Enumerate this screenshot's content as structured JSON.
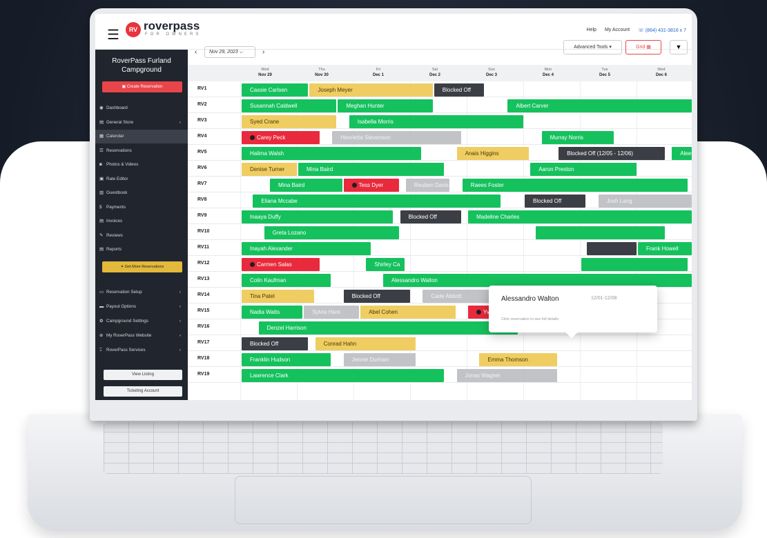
{
  "app": {
    "brand": "roverpass",
    "brand_sub": "FOR OWNERS",
    "menu_icon": "hamburger-icon",
    "logo_icon": "rv-logo-icon"
  },
  "topbar": {
    "help": "Help",
    "account": "My Account",
    "phone": "(864) 431-3816 x 7"
  },
  "sidebar": {
    "campground": "RoverPass Furland Campground",
    "create_button": "Create Reservation",
    "items": [
      {
        "label": "Dashboard",
        "icon": "dashboard-icon"
      },
      {
        "label": "General Store",
        "icon": "store-icon"
      },
      {
        "label": "Calendar",
        "icon": "calendar-icon"
      },
      {
        "label": "Reservations",
        "icon": "reservations-icon"
      },
      {
        "label": "Photos & Videos",
        "icon": "camera-icon"
      },
      {
        "label": "Rate Editor",
        "icon": "rate-icon"
      },
      {
        "label": "Guestbook",
        "icon": "book-icon"
      },
      {
        "label": "Payments",
        "icon": "dollar-icon"
      },
      {
        "label": "Invoices",
        "icon": "invoice-icon"
      },
      {
        "label": "Reviews",
        "icon": "reviews-icon"
      },
      {
        "label": "Reports",
        "icon": "reports-icon"
      }
    ],
    "get_more": "Get More Reservations",
    "settings": [
      {
        "label": "Reservation Setup",
        "icon": "setup-icon"
      },
      {
        "label": "Payout Options",
        "icon": "payout-icon"
      },
      {
        "label": "Campground Settings",
        "icon": "settings-icon"
      },
      {
        "label": "My RoverPass Website",
        "icon": "website-icon"
      },
      {
        "label": "RoverPass Services",
        "icon": "services-icon"
      }
    ],
    "view_listing": "View Listing",
    "ticketing": "Ticketing Account"
  },
  "toolbar": {
    "date": "Nov 29, 2023",
    "advanced_tools": "Advanced Tools",
    "grid": "Grid",
    "prev_arrow": "‹",
    "next_arrow": "›"
  },
  "calendar": {
    "days": [
      {
        "dow": "Wed",
        "date": "Nov 29"
      },
      {
        "dow": "Thu",
        "date": "Nov 30"
      },
      {
        "dow": "Fri",
        "date": "Dec 1"
      },
      {
        "dow": "Sat",
        "date": "Dec 2"
      },
      {
        "dow": "Sun",
        "date": "Dec 3"
      },
      {
        "dow": "Mon",
        "date": "Dec 4"
      },
      {
        "dow": "Tue",
        "date": "Dec 5"
      },
      {
        "dow": "Wed",
        "date": "Dec 6"
      },
      {
        "dow": "Thu",
        "date": "Dec"
      }
    ],
    "rows": [
      {
        "site": "RV1",
        "bars": [
          {
            "name": "Cassie Carlsen",
            "status": "checked-in",
            "start": 0,
            "len": 1.2
          },
          {
            "name": "Joseph Meyer",
            "status": "pending",
            "start": 1.2,
            "len": 2.2
          },
          {
            "name": "Blocked Off",
            "status": "blocked",
            "start": 3.4,
            "len": 0.9
          }
        ]
      },
      {
        "site": "RV2",
        "bars": [
          {
            "name": "Susannah Caldwell",
            "status": "checked-in",
            "start": 0,
            "len": 1.7
          },
          {
            "name": "Meghan Hunter",
            "status": "checked-in",
            "start": 1.7,
            "len": 1.7
          },
          {
            "name": "Albert Carver",
            "status": "checked-in",
            "start": 4.7,
            "len": 4.3
          }
        ]
      },
      {
        "site": "RV3",
        "bars": [
          {
            "name": "Syed Crane",
            "status": "pending",
            "start": 0,
            "len": 1.7
          },
          {
            "name": "Isabella Morris",
            "status": "checked-in",
            "start": 1.9,
            "len": 3.1
          }
        ]
      },
      {
        "site": "RV4",
        "bars": [
          {
            "name": "Carey Peck",
            "status": "cancelled",
            "start": 0,
            "len": 1.4
          },
          {
            "name": "Henrietta Stevenson",
            "status": "unconfirmed",
            "start": 1.6,
            "len": 2.3
          },
          {
            "name": "Murray Norris",
            "status": "checked-in",
            "start": 5.3,
            "len": 1.3
          }
        ]
      },
      {
        "site": "RV5",
        "bars": [
          {
            "name": "Halima Walsh",
            "status": "checked-in",
            "start": 0,
            "len": 3.2
          },
          {
            "name": "Anais Higgins",
            "status": "pending",
            "start": 3.8,
            "len": 1.3
          },
          {
            "name": "Blocked Off (12/05 - 12/06)",
            "status": "blocked",
            "start": 5.6,
            "len": 1.9
          },
          {
            "name": "Aleesh",
            "status": "checked-in",
            "start": 7.6,
            "len": 0.8
          }
        ]
      },
      {
        "site": "RV6",
        "bars": [
          {
            "name": "Denise Turner",
            "status": "pending",
            "start": 0,
            "len": 1.0
          },
          {
            "name": "Mina Baird",
            "status": "checked-in",
            "start": 1.0,
            "len": 2.6
          },
          {
            "name": "Aaron Preston",
            "status": "checked-in",
            "start": 5.1,
            "len": 1.9
          }
        ]
      },
      {
        "site": "RV7",
        "bars": [
          {
            "name": "Mina Baird",
            "status": "checked-in",
            "start": 0.5,
            "len": 1.3
          },
          {
            "name": "Tess Dyer",
            "status": "cancelled",
            "start": 1.8,
            "len": 1.0
          },
          {
            "name": "Reuben Davis",
            "status": "unconfirmed",
            "start": 2.9,
            "len": 0.8
          },
          {
            "name": "Raees Foster",
            "status": "checked-in",
            "start": 3.9,
            "len": 4.0
          }
        ]
      },
      {
        "site": "RV8",
        "bars": [
          {
            "name": "Eliana Mccabe",
            "status": "checked-in",
            "start": 0.2,
            "len": 4.4
          },
          {
            "name": "Blocked Off",
            "status": "blocked",
            "start": 5.0,
            "len": 1.1
          },
          {
            "name": "Josh Lang",
            "status": "unconfirmed",
            "start": 6.3,
            "len": 1.9
          }
        ]
      },
      {
        "site": "RV9",
        "bars": [
          {
            "name": "Inaaya Duffy",
            "status": "checked-in",
            "start": 0,
            "len": 2.7
          },
          {
            "name": "Blocked Off",
            "status": "blocked",
            "start": 2.8,
            "len": 1.1
          },
          {
            "name": "Madeline Charles",
            "status": "checked-in",
            "start": 4.0,
            "len": 4.2
          }
        ]
      },
      {
        "site": "RV10",
        "bars": [
          {
            "name": "Greta Lozano",
            "status": "checked-in",
            "start": 0.4,
            "len": 2.4
          },
          {
            "name": "",
            "status": "checked-in",
            "start": 5.2,
            "len": 2.3
          }
        ]
      },
      {
        "site": "RV11",
        "bars": [
          {
            "name": "Inayah Alexander",
            "status": "checked-in",
            "start": 0,
            "len": 2.3
          },
          {
            "name": "",
            "status": "blocked",
            "start": 6.1,
            "len": 0.9
          },
          {
            "name": "Frank Howell",
            "status": "checked-in",
            "start": 7.0,
            "len": 1.5
          }
        ]
      },
      {
        "site": "RV12",
        "bars": [
          {
            "name": "Carmen Salas",
            "status": "cancelled",
            "start": 0,
            "len": 1.4
          },
          {
            "name": "Shirley Ca",
            "status": "checked-in",
            "start": 2.2,
            "len": 0.7
          },
          {
            "name": "",
            "status": "checked-in",
            "start": 6.0,
            "len": 1.9
          }
        ]
      },
      {
        "site": "RV13",
        "bars": [
          {
            "name": "Colin Kaufman",
            "status": "checked-in",
            "start": 0,
            "len": 1.6
          },
          {
            "name": "Alessandro Walton",
            "status": "checked-in",
            "start": 2.5,
            "len": 6.0
          }
        ]
      },
      {
        "site": "RV14",
        "bars": [
          {
            "name": "Tina Patel",
            "status": "pending",
            "start": 0,
            "len": 1.3
          },
          {
            "name": "Blocked Off",
            "status": "blocked",
            "start": 1.8,
            "len": 1.2
          },
          {
            "name": "Cade Abbott",
            "status": "unconfirmed",
            "start": 3.2,
            "len": 1.6
          }
        ]
      },
      {
        "site": "RV15",
        "bars": [
          {
            "name": "Nadia Watts",
            "status": "checked-in",
            "start": 0,
            "len": 1.1
          },
          {
            "name": "Sylvia Hare",
            "status": "unconfirmed",
            "start": 1.1,
            "len": 1.0
          },
          {
            "name": "Abel Cohen",
            "status": "pending",
            "start": 2.1,
            "len": 1.7
          },
          {
            "name": "Yvette Frederick",
            "status": "cancelled",
            "start": 4.0,
            "len": 2.1
          }
        ]
      },
      {
        "site": "RV16",
        "bars": [
          {
            "name": "Denzel Harrison",
            "status": "checked-in",
            "start": 0.3,
            "len": 4.6
          }
        ]
      },
      {
        "site": "RV17",
        "bars": [
          {
            "name": "Blocked Off",
            "status": "blocked",
            "start": 0,
            "len": 1.2
          },
          {
            "name": "Conrad Hahn",
            "status": "pending",
            "start": 1.3,
            "len": 1.8
          }
        ]
      },
      {
        "site": "RV18",
        "bars": [
          {
            "name": "Franklin Hudson",
            "status": "checked-in",
            "start": 0,
            "len": 1.6
          },
          {
            "name": "Jennie Durham",
            "status": "unconfirmed",
            "start": 1.8,
            "len": 1.3
          },
          {
            "name": "Emma Thomson",
            "status": "pending",
            "start": 4.2,
            "len": 1.4
          }
        ]
      },
      {
        "site": "RV19",
        "bars": [
          {
            "name": "Lawrence Clark",
            "status": "checked-in",
            "start": 0,
            "len": 3.6
          },
          {
            "name": "Jonas Wagner",
            "status": "unconfirmed",
            "start": 3.8,
            "len": 1.8
          }
        ]
      }
    ]
  },
  "popup": {
    "name": "Alessandro Walton",
    "dates": "12/01-12/08",
    "hint": "Click reservation to see full details"
  },
  "colors": {
    "checked-in": "#15c15d",
    "pending": "#efcd62",
    "cancelled": "#e82a3c",
    "blocked": "#3b3e44",
    "unconfirmed": "#c1c3c6",
    "brand": "#e8343c"
  }
}
